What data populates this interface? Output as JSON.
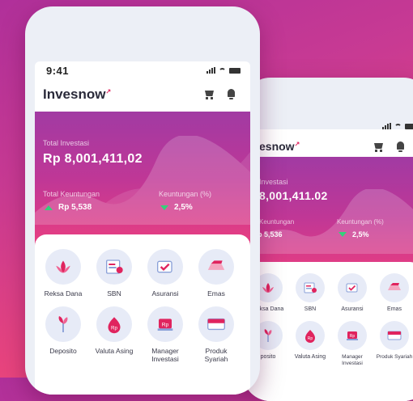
{
  "status": {
    "time": "9:41"
  },
  "app": {
    "logo": "Invesnow",
    "logo_partial": "esnow"
  },
  "hero": {
    "total_label": "Total Investasi",
    "total_label_partial": "Investasi",
    "total_value": "Rp 8,001,411,02",
    "total_value_partial": "8,001,411.02",
    "gain_label": "Total Keuntungan",
    "gain_label_partial": "Keuntungan",
    "gain_value": "Rp 5,538",
    "gain_value_partial": "p 5,536",
    "pct_label": "Keuntungan (%)",
    "pct_value": "2,5%",
    "pct_value_partial": "2,5%"
  },
  "menu": [
    {
      "label": "Reksa Dana",
      "icon": "reksa-dana-icon"
    },
    {
      "label": "SBN",
      "icon": "sbn-icon"
    },
    {
      "label": "Asuransi",
      "icon": "asuransi-icon"
    },
    {
      "label": "Emas",
      "icon": "emas-icon"
    },
    {
      "label": "Deposito",
      "icon": "deposito-icon"
    },
    {
      "label": "Valuta Asing",
      "icon": "valuta-asing-icon"
    },
    {
      "label": "Manager Investasi",
      "icon": "manager-investasi-icon"
    },
    {
      "label": "Produk Syariah",
      "icon": "produk-syariah-icon"
    }
  ],
  "menu_partial": {
    "reksa": "Reksa Dana",
    "deposito": "posito",
    "syariah": "Produk Syariah"
  },
  "colors": {
    "accent": "#e0245e",
    "gain": "#33d17a",
    "hero_top": "#a13aa3",
    "hero_bottom": "#ea3f80"
  }
}
